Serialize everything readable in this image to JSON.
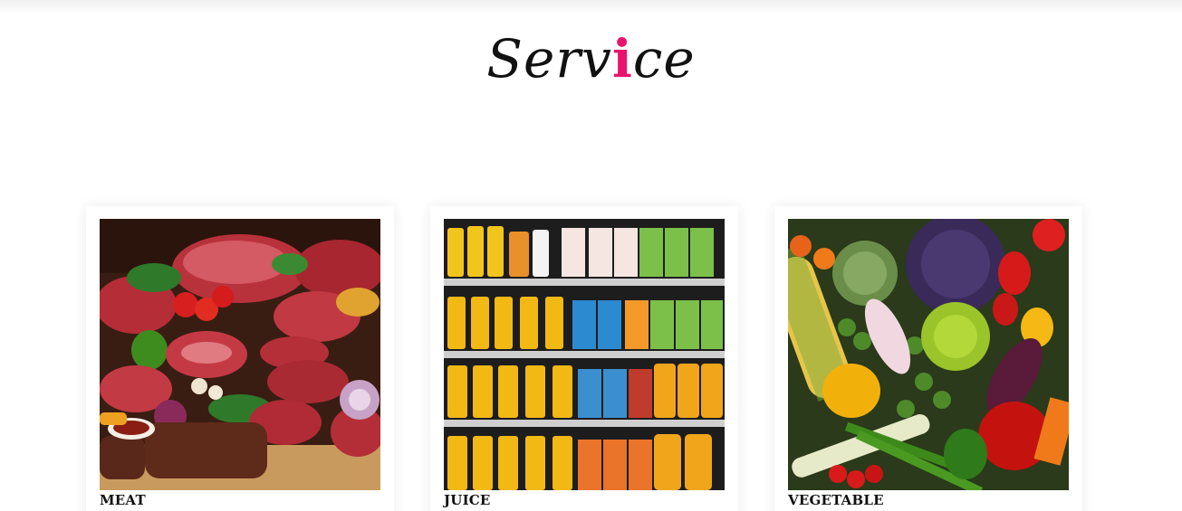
{
  "section": {
    "title_part1": "Serv",
    "title_accent": "i",
    "title_part2": "ce",
    "accent_color": "#e8146c"
  },
  "cards": [
    {
      "label": "MEAT",
      "image": "meat-photo"
    },
    {
      "label": "JUICE",
      "image": "juice-shelf-photo"
    },
    {
      "label": "VEGETABLE",
      "image": "vegetable-photo"
    }
  ]
}
